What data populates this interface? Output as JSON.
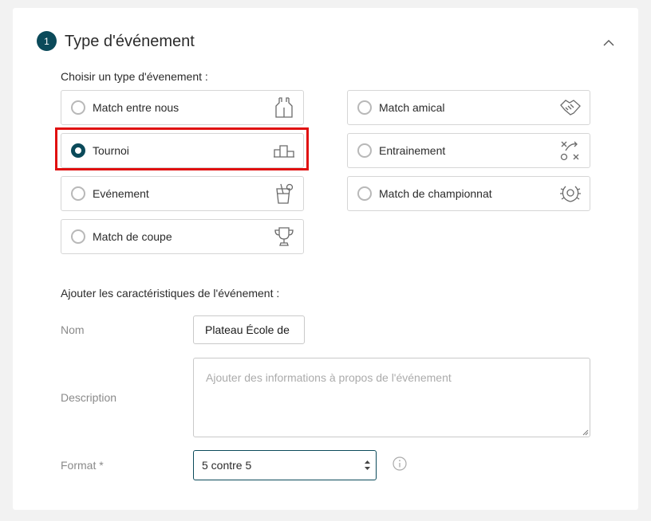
{
  "section": {
    "step_number": "1",
    "title": "Type d'événement"
  },
  "choose_label": "Choisir un type d'évenement :",
  "event_types": [
    {
      "label": "Match entre nous",
      "icon": "jersey-icon",
      "selected": false
    },
    {
      "label": "Match amical",
      "icon": "handshake-icon",
      "selected": false
    },
    {
      "label": "Tournoi",
      "icon": "podium-icon",
      "selected": true
    },
    {
      "label": "Entrainement",
      "icon": "tactics-icon",
      "selected": false
    },
    {
      "label": "Evénement",
      "icon": "drink-icon",
      "selected": false
    },
    {
      "label": "Match de championnat",
      "icon": "laurel-icon",
      "selected": false
    },
    {
      "label": "Match de coupe",
      "icon": "trophy-icon",
      "selected": false
    }
  ],
  "characteristics_label": "Ajouter les caractéristiques de l'événement :",
  "fields": {
    "name_label": "Nom",
    "name_value": "Plateau École de",
    "description_label": "Description",
    "description_placeholder": "Ajouter des informations à propos de l'événement",
    "format_label": "Format *",
    "format_value": "5 contre 5"
  },
  "colors": {
    "accent": "#0b4a5a",
    "highlight": "#e01010",
    "border": "#d6d6d6",
    "background": "#f2f2f2"
  }
}
